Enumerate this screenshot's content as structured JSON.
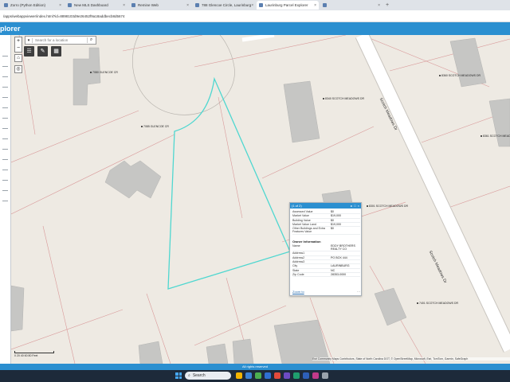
{
  "browser": {
    "tabs": [
      {
        "label": "Zorro (Python Edition)",
        "active": false
      },
      {
        "label": "New MLS Dashboard",
        "active": false
      },
      {
        "label": "Remine Web",
        "active": false
      },
      {
        "label": "788 Glencoe Circle, Laurinburg",
        "active": false
      },
      {
        "label": "Laurinburg Parcel Explorer",
        "active": true
      },
      {
        "label": "",
        "active": false
      }
    ],
    "new_tab": "+",
    "url": "/apps/webappviewer/index.html?id=8898103d9e26452f9a18addbecb8d5674"
  },
  "app": {
    "title": "plorer",
    "footer": "All rights reserved"
  },
  "search": {
    "placeholder": "Search for a location"
  },
  "map": {
    "labels": [
      {
        "text": "7080 GLENCOE CR",
        "cls": "addrlabel",
        "pos": "l1"
      },
      {
        "text": "7085 GLENCOE CR",
        "cls": "addrlabel",
        "pos": "l2"
      },
      {
        "text": "8340 SCOTCH MEADOWS DR",
        "cls": "addrlabel",
        "pos": "l3"
      },
      {
        "text": "8360 SCOTCH MEADOWS DR",
        "cls": "addrlabel",
        "pos": "l4"
      },
      {
        "text": "8301 SCOTCH MEADOWS DR",
        "cls": "addrlabel",
        "pos": "l5"
      },
      {
        "text": "8361 SCOTCH MEADOWS DR",
        "cls": "addrlabel",
        "pos": "l6"
      },
      {
        "text": "7401 SCOTCH MEADOWS DR",
        "cls": "addrlabel",
        "pos": "l7"
      },
      {
        "text": "Scotch Meadows Dr",
        "cls": "streetlabel",
        "pos": "s1"
      },
      {
        "text": "Scotch Meadows Dr",
        "cls": "streetlabel",
        "pos": "s2"
      }
    ],
    "scale": "0 20 40 60 80 Feet",
    "attribution": "Esri Community Maps Contributors, State of North Carolina DOT, © OpenStreetMap, Microsoft, Esri, TomTom, Garmin, SafeGraph"
  },
  "popup": {
    "title": "(1 of 2)",
    "property_rows": [
      {
        "k": "Assessed Value",
        "v": "$0"
      },
      {
        "k": "Market Value",
        "v": "$19,000"
      },
      {
        "k": "Building Value",
        "v": "$0"
      },
      {
        "k": "Market Value Land",
        "v": "$19,000"
      },
      {
        "k": "Other Buildings and Extra Features Value",
        "v": "$0"
      }
    ],
    "owner_heading": "Owner Information",
    "owner_rows": [
      {
        "k": "Name",
        "v": "EDDY BROTHERS REALTY CO"
      },
      {
        "k": "Address1",
        "v": ""
      },
      {
        "k": "Address2",
        "v": "PO BOX 444"
      },
      {
        "k": "Address3",
        "v": ""
      },
      {
        "k": "City",
        "v": "LAURINBURG"
      },
      {
        "k": "State",
        "v": "NC"
      },
      {
        "k": "Zip Code",
        "v": "28353-0000"
      }
    ],
    "zoom_to": "Zoom to"
  },
  "taskbar": {
    "search_placeholder": "Search"
  }
}
